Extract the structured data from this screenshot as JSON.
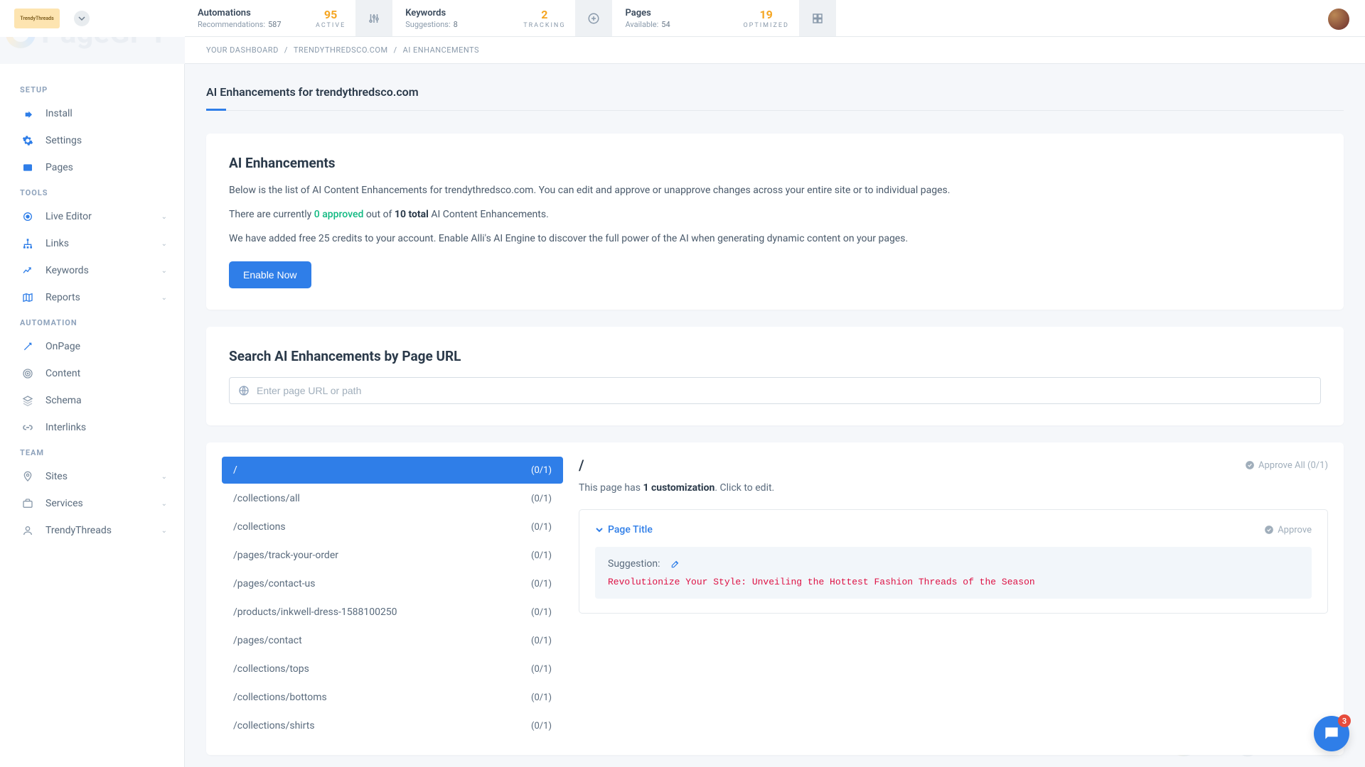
{
  "watermark": "PageGPT",
  "logo": {
    "text": "TrendyThreads"
  },
  "topbar": {
    "automations": {
      "title": "Automations",
      "sub_label": "Recommendations:",
      "sub_value": "587",
      "big": "95",
      "big_label": "ACTIVE"
    },
    "keywords": {
      "title": "Keywords",
      "sub_label": "Suggestions:",
      "sub_value": "8",
      "big": "2",
      "big_label": "TRACKING"
    },
    "pages": {
      "title": "Pages",
      "sub_label": "Available:",
      "sub_value": "54",
      "big": "19",
      "big_label": "OPTIMIZED"
    }
  },
  "breadcrumb": {
    "dashboard": "YOUR DASHBOARD",
    "site": "TRENDYTHREDSCO.COM",
    "current": "AI ENHANCEMENTS",
    "sep": "/"
  },
  "sidebar": {
    "setup_label": "SETUP",
    "tools_label": "TOOLS",
    "automation_label": "AUTOMATION",
    "team_label": "TEAM",
    "install": "Install",
    "settings": "Settings",
    "pages": "Pages",
    "live_editor": "Live Editor",
    "links": "Links",
    "keywords": "Keywords",
    "reports": "Reports",
    "onpage": "OnPage",
    "content": "Content",
    "schema": "Schema",
    "interlinks": "Interlinks",
    "sites": "Sites",
    "services": "Services",
    "trendy": "TrendyThreads"
  },
  "page": {
    "title": "AI Enhancements for trendythredsco.com",
    "intro_heading": "AI Enhancements",
    "intro_p1": "Below is the list of AI Content Enhancements for trendythredsco.com. You can edit and approve or unapprove changes across your entire site or to individual pages.",
    "intro_p2_a": "There are currently ",
    "intro_p2_b": "0 approved",
    "intro_p2_c": " out of ",
    "intro_p2_d": "10 total",
    "intro_p2_e": " AI Content Enhancements.",
    "intro_p3": "We have added free 25 credits to your account. Enable Alli's AI Engine to discover the full power of the AI when generating dynamic content on your pages.",
    "enable_btn": "Enable Now",
    "search_heading": "Search AI Enhancements by Page URL",
    "search_placeholder": "Enter page URL or path",
    "urls": [
      {
        "path": "/",
        "count": "(0/1)"
      },
      {
        "path": "/collections/all",
        "count": "(0/1)"
      },
      {
        "path": "/collections",
        "count": "(0/1)"
      },
      {
        "path": "/pages/track-your-order",
        "count": "(0/1)"
      },
      {
        "path": "/pages/contact-us",
        "count": "(0/1)"
      },
      {
        "path": "/products/inkwell-dress-1588100250",
        "count": "(0/1)"
      },
      {
        "path": "/pages/contact",
        "count": "(0/1)"
      },
      {
        "path": "/collections/tops",
        "count": "(0/1)"
      },
      {
        "path": "/collections/bottoms",
        "count": "(0/1)"
      },
      {
        "path": "/collections/shirts",
        "count": "(0/1)"
      }
    ],
    "detail": {
      "path": "/",
      "approve_all": "Approve All (0/1)",
      "desc_a": "This page has ",
      "desc_b": "1 customization",
      "desc_c": ". Click to edit.",
      "enh_title": "Page Title",
      "approve": "Approve",
      "suggestion_label": "Suggestion:",
      "suggestion_text": "Revolutionize Your Style: Unveiling the Hottest Fashion Threads of the Season"
    }
  },
  "chat": {
    "badge": "3"
  }
}
